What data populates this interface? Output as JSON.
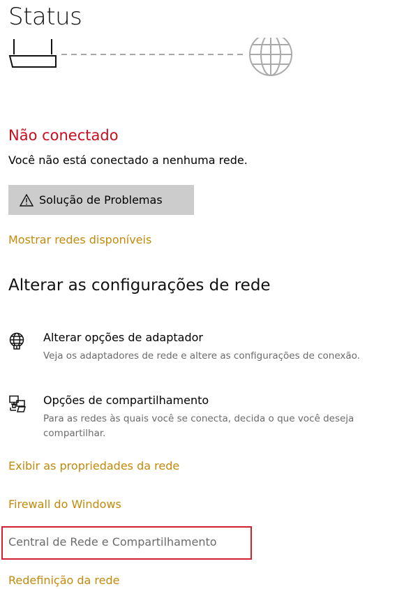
{
  "header": {
    "title": "Status"
  },
  "connection": {
    "graphic_icons": [
      "router-icon",
      "globe-icon"
    ],
    "status_heading": "Não conectado",
    "status_description": "Você não está conectado a nenhuma rede.",
    "troubleshoot_label": "Solução de Problemas",
    "show_networks_link": "Mostrar redes disponíveis",
    "colors": {
      "error_red": "#c50f1f",
      "link_gold": "#c28a0c",
      "highlight_red": "#d32030"
    }
  },
  "settings": {
    "heading": "Alterar as configurações de rede",
    "items": [
      {
        "icon": "globe-adapter-icon",
        "title": "Alterar opções de adaptador",
        "description": "Veja os adaptadores de rede e altere as configurações de conexão."
      },
      {
        "icon": "sharing-icon",
        "title": "Opções de compartilhamento",
        "description": "Para as redes às quais você se conecta, decida o que você deseja compartilhar."
      }
    ]
  },
  "links": {
    "network_properties": "Exibir as propriedades da rede",
    "windows_firewall": "Firewall do Windows",
    "network_sharing_center": "Central de Rede e Compartilhamento",
    "network_reset": "Redefinição da rede"
  }
}
